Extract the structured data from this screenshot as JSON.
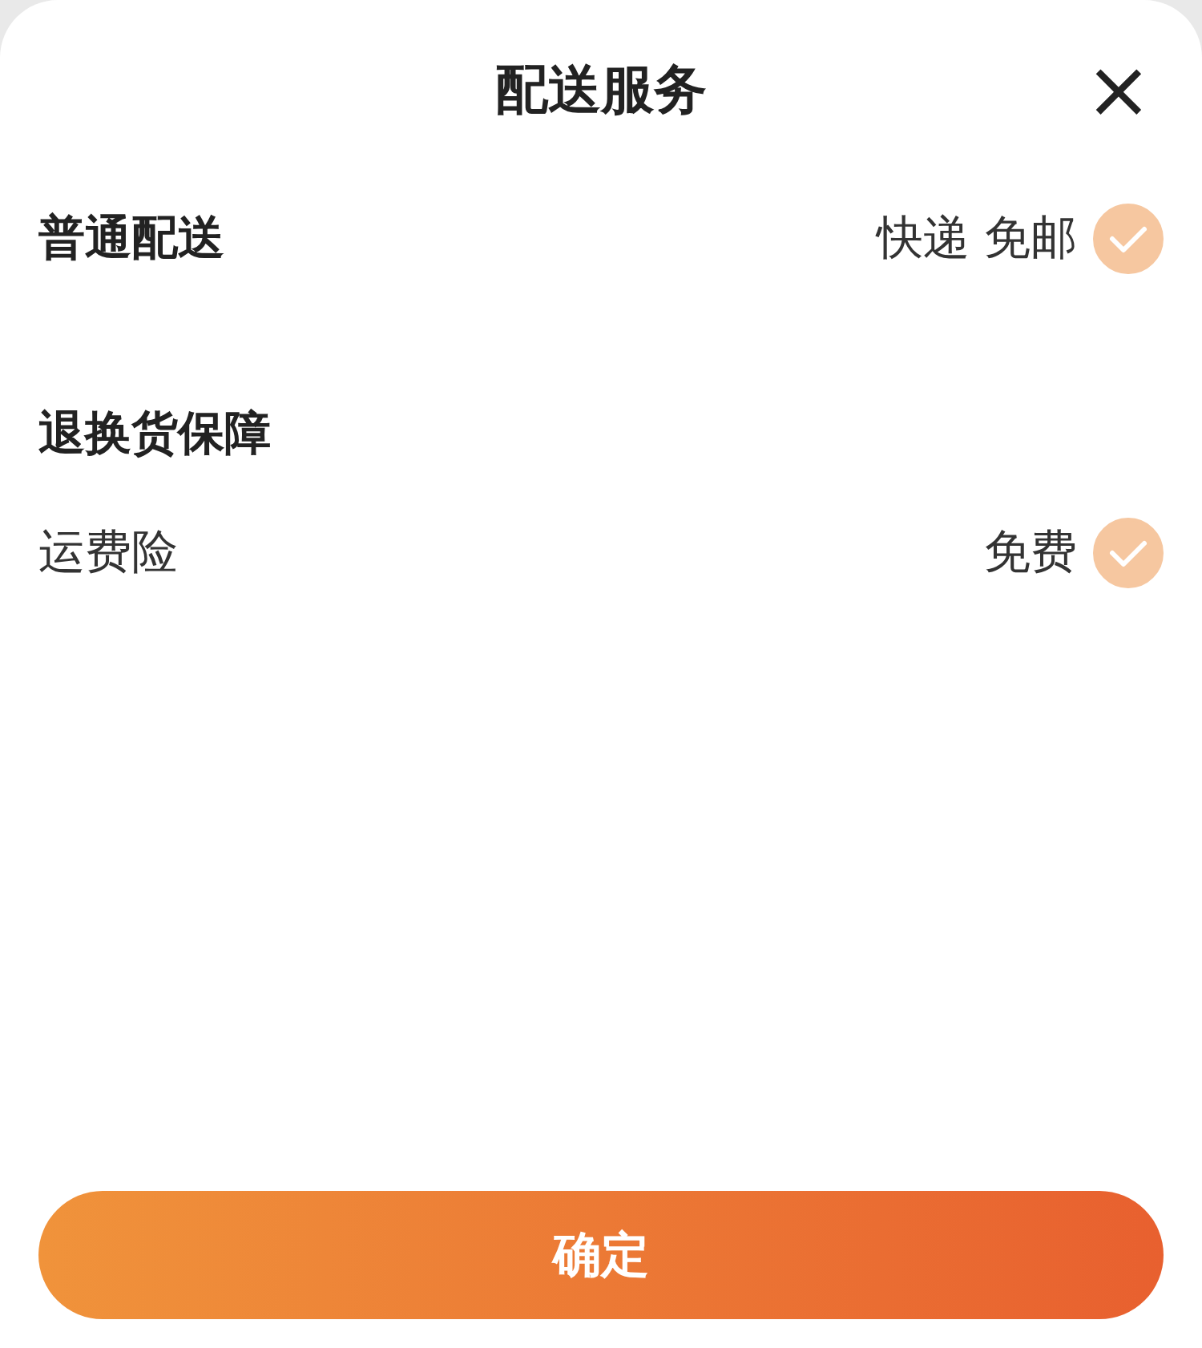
{
  "title": "配送服务",
  "close": "×",
  "sections": [
    {
      "rows": [
        {
          "label": "普通配送",
          "bold": true,
          "value": "快递 免邮",
          "checked": true
        }
      ]
    },
    {
      "heading": "退换货保障",
      "rows": [
        {
          "label": "运费险",
          "bold": false,
          "value": "免费",
          "checked": true
        }
      ]
    }
  ],
  "confirm_button": "确定"
}
